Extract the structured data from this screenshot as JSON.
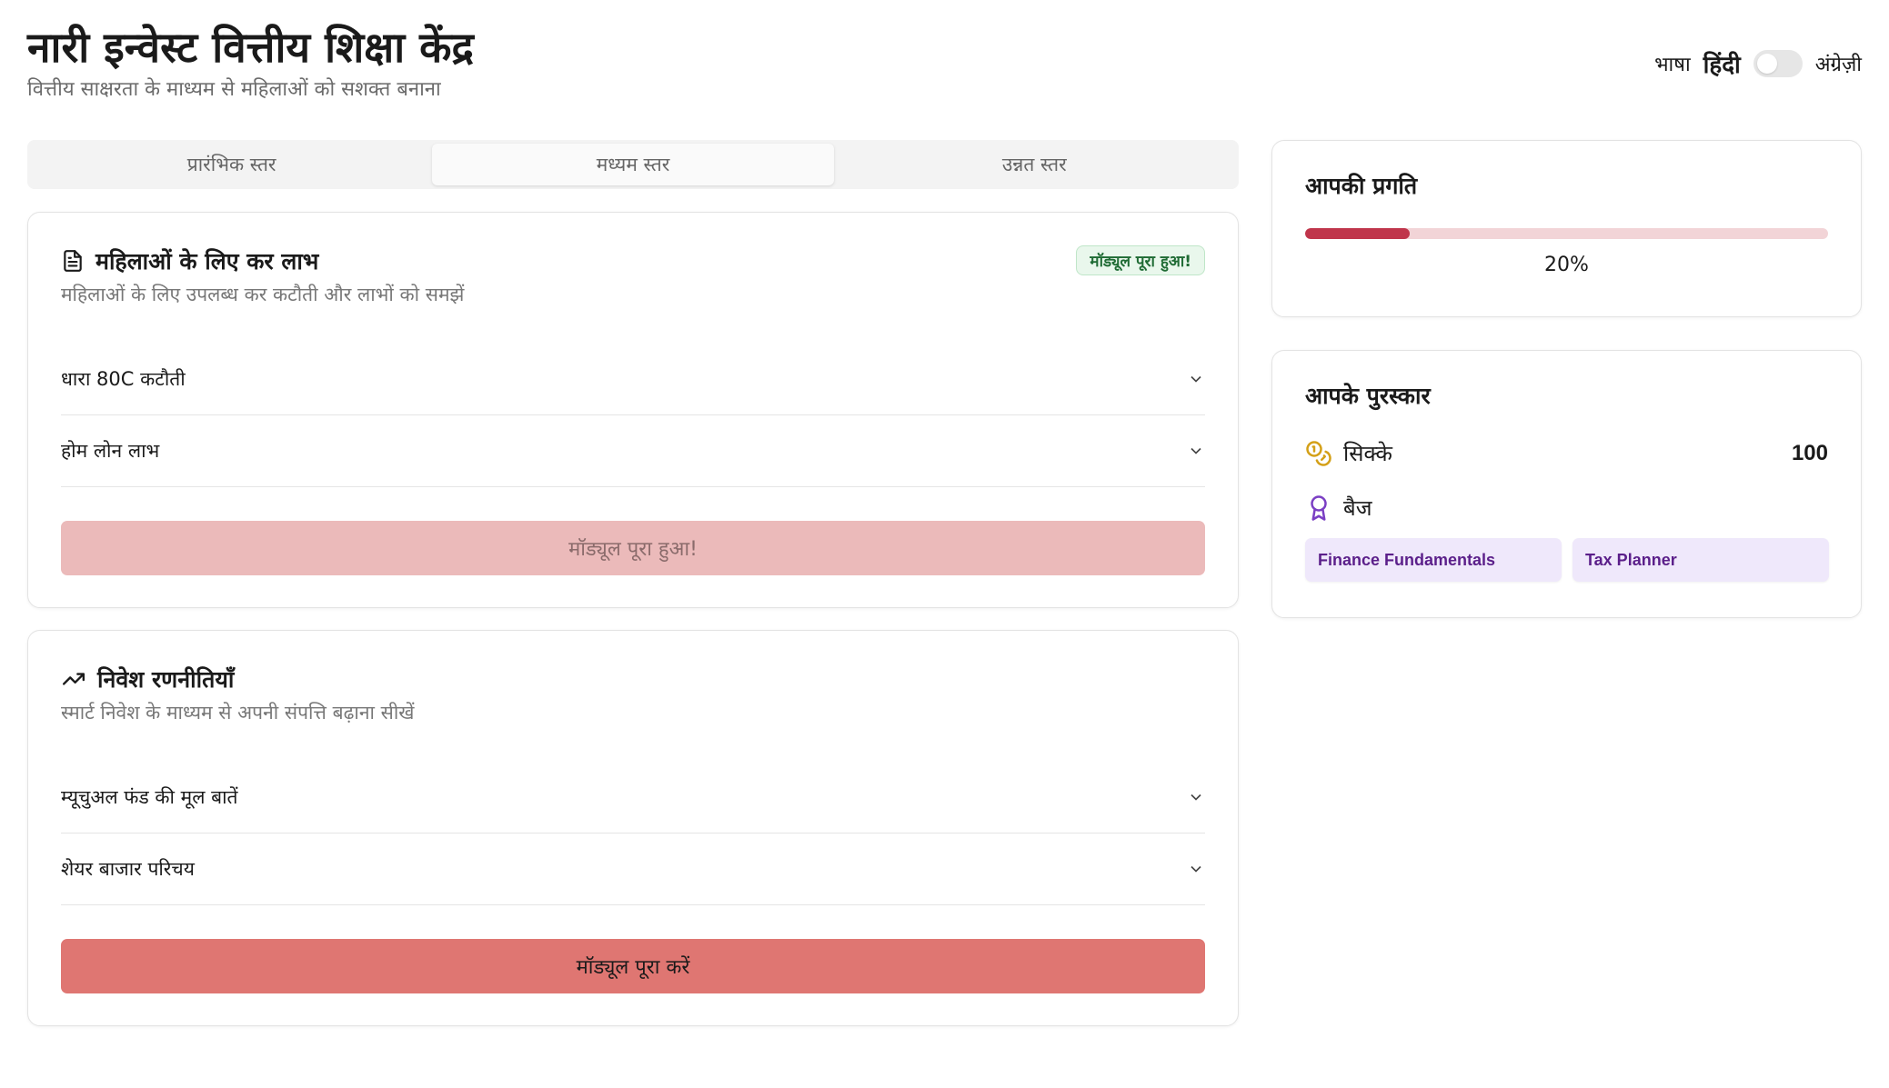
{
  "header": {
    "title": "नारी इन्वेस्ट वित्तीय शिक्षा केंद्र",
    "subtitle": "वित्तीय साक्षरता के माध्यम से महिलाओं को सशक्त बनाना"
  },
  "language": {
    "label": "भाषा",
    "hindi": "हिंदी",
    "english": "अंग्रेज़ी"
  },
  "tabs": [
    {
      "label": "प्रारंभिक स्तर",
      "selected": false
    },
    {
      "label": "मध्यम स्तर",
      "selected": true
    },
    {
      "label": "उन्नत स्तर",
      "selected": false
    }
  ],
  "modules": [
    {
      "icon": "document-icon",
      "title": "महिलाओं के लिए कर लाभ",
      "description": "महिलाओं के लिए उपलब्ध कर कटौती और लाभों को समझें",
      "badge": "मॉड्यूल पूरा हुआ!",
      "sections": [
        "धारा 80C कटौती",
        "होम लोन लाभ"
      ],
      "button": "मॉड्यूल पूरा हुआ!",
      "completed": true
    },
    {
      "icon": "trending-up-icon",
      "title": "निवेश रणनीतियाँ",
      "description": "स्मार्ट निवेश के माध्यम से अपनी संपत्ति बढ़ाना सीखें",
      "badge": "",
      "sections": [
        "म्यूचुअल फंड की मूल बातें",
        "शेयर बाजार परिचय"
      ],
      "button": "मॉड्यूल पूरा करें",
      "completed": false
    }
  ],
  "progress": {
    "title": "आपकी प्रगति",
    "percent": 20,
    "label": "20%"
  },
  "rewards": {
    "title": "आपके पुरस्कार",
    "coins_label": "सिक्के",
    "coins_value": "100",
    "badges_label": "बैज",
    "badges": [
      "Finance Fundamentals",
      "Tax Planner"
    ]
  },
  "colors": {
    "accent": "#c0354b",
    "button_active": "#df7672",
    "button_done": "#ebbaba",
    "badge_bg": "#efe8fb",
    "badge_text": "#5b1f8a",
    "coin": "#d4a017",
    "award": "#7b3fc4"
  }
}
